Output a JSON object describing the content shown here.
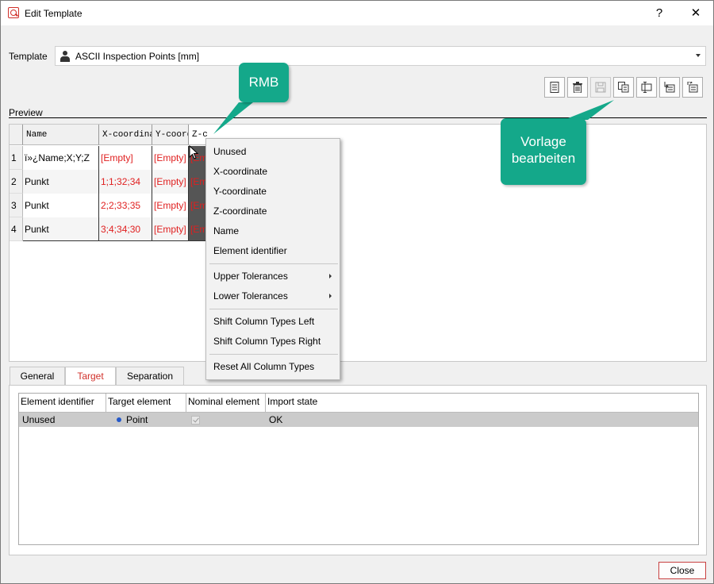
{
  "window": {
    "title": "Edit Template",
    "help_label": "?",
    "close_label": "✕"
  },
  "template": {
    "label": "Template",
    "value": "ASCII Inspection Points [mm]"
  },
  "toolbar": {
    "buttons": [
      "new-icon",
      "delete-icon",
      "save-icon",
      "copy-icon",
      "rename-icon",
      "import-icon",
      "export-icon"
    ]
  },
  "preview": {
    "label": "Preview",
    "columns": [
      "Name",
      "X-coordina",
      "Y-coord",
      "Z-coord"
    ],
    "rows": [
      {
        "num": "1",
        "name": "ï»¿Name;X;Y;Z",
        "x": "[Empty]",
        "y": "[Empty]",
        "z": "[Em"
      },
      {
        "num": "2",
        "name": "Punkt",
        "x": "1;1;32;34",
        "y": "[Empty]",
        "z": "[Em"
      },
      {
        "num": "3",
        "name": "Punkt",
        "x": "2;2;33;35",
        "y": "[Empty]",
        "z": "[Em"
      },
      {
        "num": "4",
        "name": "Punkt",
        "x": "3;4;34;30",
        "y": "[Empty]",
        "z": "[Em"
      }
    ]
  },
  "context_menu": {
    "items": [
      "Unused",
      "X-coordinate",
      "Y-coordinate",
      "Z-coordinate",
      "Name",
      "Element identifier",
      "Upper Tolerances",
      "Lower Tolerances",
      "Shift Column Types Left",
      "Shift Column Types Right",
      "Reset All Column Types"
    ]
  },
  "tabs": {
    "general": "General",
    "target": "Target",
    "separation": "Separation",
    "active": "Target"
  },
  "target_table": {
    "headers": [
      "Element identifier",
      "Target element",
      "Nominal element",
      "Import state"
    ],
    "row": {
      "element_identifier": "Unused",
      "target_element": "Point",
      "nominal_checked": true,
      "import_state": "OK"
    }
  },
  "footer": {
    "close_label": "Close"
  },
  "callouts": {
    "rmb": "RMB",
    "vorlage_line1": "Vorlage",
    "vorlage_line2": "bearbeiten"
  },
  "colors": {
    "accent_red": "#d0302a",
    "callout_green": "#14a88a",
    "empty_red": "#e02020"
  }
}
